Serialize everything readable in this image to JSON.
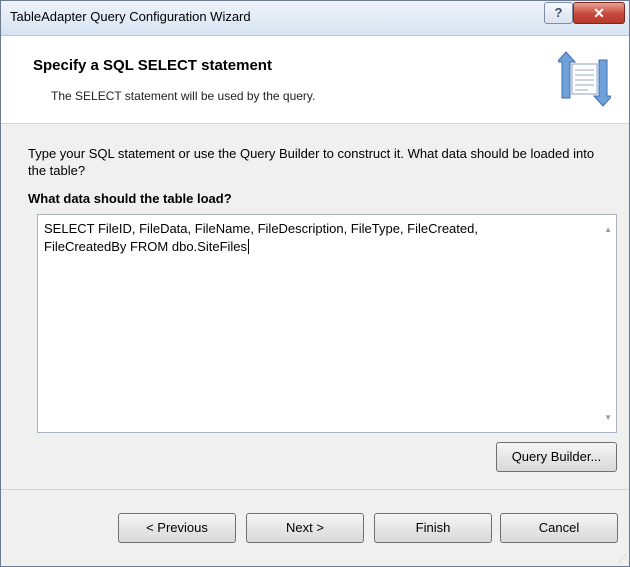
{
  "window": {
    "title": "TableAdapter Query Configuration Wizard",
    "help_label": "?",
    "close_label": "✕"
  },
  "header": {
    "title": "Specify a SQL SELECT statement",
    "subtitle": "The SELECT statement will be used by the query.",
    "icon": "wizard-data-icon"
  },
  "body": {
    "description": "Type your SQL statement or use the Query Builder to construct it. What data should be loaded into the table?",
    "prompt_label": "What data should the table load?",
    "sql_text": "SELECT FileID, FileData, FileName, FileDescription, FileType, FileCreated,\nFileCreatedBy FROM dbo.SiteFiles",
    "query_builder_label": "Query Builder..."
  },
  "footer": {
    "previous_label": "< Previous",
    "next_label": "Next >",
    "finish_label": "Finish",
    "cancel_label": "Cancel"
  },
  "colors": {
    "close_button": "#c6483a",
    "dialog_background": "#f0f0f0",
    "header_background": "#ffffff",
    "icon_blue": "#5a8fcf"
  }
}
